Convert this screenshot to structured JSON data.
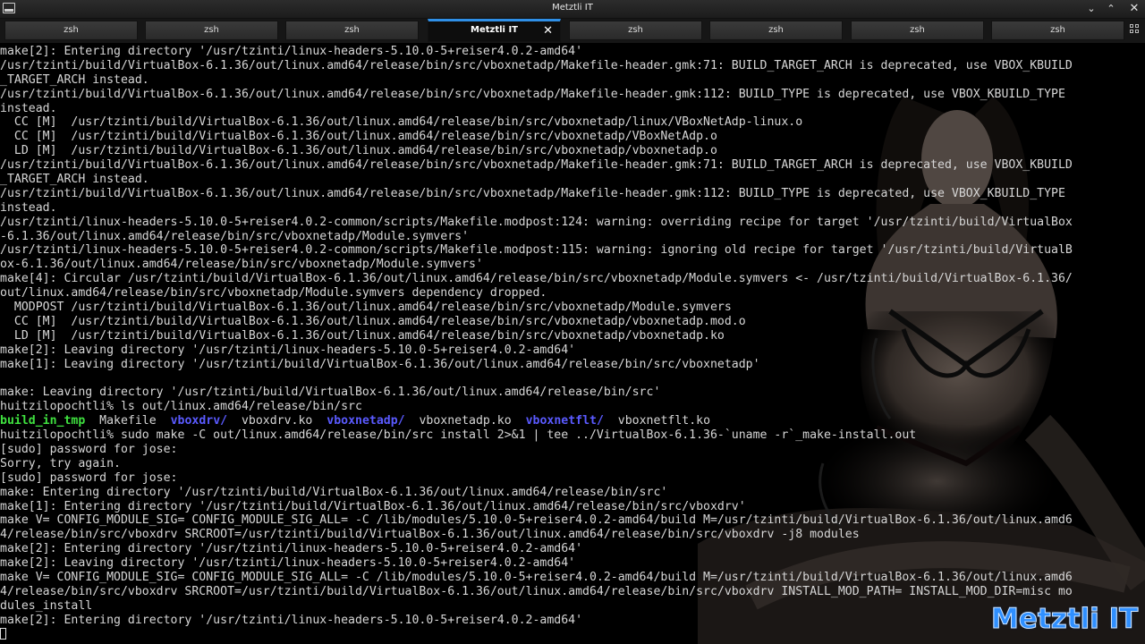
{
  "window": {
    "title": "Metztli IT"
  },
  "controls": {
    "minimize_glyph": "⌄",
    "maximize_glyph": "⌃",
    "close_glyph": "✕"
  },
  "tabs": [
    {
      "label": "zsh"
    },
    {
      "label": "zsh"
    },
    {
      "label": "zsh"
    },
    {
      "label": "Metztli IT",
      "active": true
    },
    {
      "label": "zsh"
    },
    {
      "label": "zsh"
    },
    {
      "label": "zsh"
    },
    {
      "label": "zsh"
    }
  ],
  "tab_close_glyph": "✕",
  "terminal": {
    "lines": [
      "make[2]: Entering directory '/usr/tzinti/linux-headers-5.10.0-5+reiser4.0.2-amd64'",
      "/usr/tzinti/build/VirtualBox-6.1.36/out/linux.amd64/release/bin/src/vboxnetadp/Makefile-header.gmk:71: BUILD_TARGET_ARCH is deprecated, use VBOX_KBUILD",
      "_TARGET_ARCH instead.",
      "/usr/tzinti/build/VirtualBox-6.1.36/out/linux.amd64/release/bin/src/vboxnetadp/Makefile-header.gmk:112: BUILD_TYPE is deprecated, use VBOX_KBUILD_TYPE",
      "instead.",
      "  CC [M]  /usr/tzinti/build/VirtualBox-6.1.36/out/linux.amd64/release/bin/src/vboxnetadp/linux/VBoxNetAdp-linux.o",
      "  CC [M]  /usr/tzinti/build/VirtualBox-6.1.36/out/linux.amd64/release/bin/src/vboxnetadp/VBoxNetAdp.o",
      "  LD [M]  /usr/tzinti/build/VirtualBox-6.1.36/out/linux.amd64/release/bin/src/vboxnetadp/vboxnetadp.o",
      "/usr/tzinti/build/VirtualBox-6.1.36/out/linux.amd64/release/bin/src/vboxnetadp/Makefile-header.gmk:71: BUILD_TARGET_ARCH is deprecated, use VBOX_KBUILD",
      "_TARGET_ARCH instead.",
      "/usr/tzinti/build/VirtualBox-6.1.36/out/linux.amd64/release/bin/src/vboxnetadp/Makefile-header.gmk:112: BUILD_TYPE is deprecated, use VBOX_KBUILD_TYPE",
      "instead.",
      "/usr/tzinti/linux-headers-5.10.0-5+reiser4.0.2-common/scripts/Makefile.modpost:124: warning: overriding recipe for target '/usr/tzinti/build/VirtualBox",
      "-6.1.36/out/linux.amd64/release/bin/src/vboxnetadp/Module.symvers'",
      "/usr/tzinti/linux-headers-5.10.0-5+reiser4.0.2-common/scripts/Makefile.modpost:115: warning: ignoring old recipe for target '/usr/tzinti/build/VirtualB",
      "ox-6.1.36/out/linux.amd64/release/bin/src/vboxnetadp/Module.symvers'",
      "make[4]: Circular /usr/tzinti/build/VirtualBox-6.1.36/out/linux.amd64/release/bin/src/vboxnetadp/Module.symvers <- /usr/tzinti/build/VirtualBox-6.1.36/",
      "out/linux.amd64/release/bin/src/vboxnetadp/Module.symvers dependency dropped.",
      "  MODPOST /usr/tzinti/build/VirtualBox-6.1.36/out/linux.amd64/release/bin/src/vboxnetadp/Module.symvers",
      "  CC [M]  /usr/tzinti/build/VirtualBox-6.1.36/out/linux.amd64/release/bin/src/vboxnetadp/vboxnetadp.mod.o",
      "  LD [M]  /usr/tzinti/build/VirtualBox-6.1.36/out/linux.amd64/release/bin/src/vboxnetadp/vboxnetadp.ko",
      "make[2]: Leaving directory '/usr/tzinti/linux-headers-5.10.0-5+reiser4.0.2-amd64'",
      "make[1]: Leaving directory '/usr/tzinti/build/VirtualBox-6.1.36/out/linux.amd64/release/bin/src/vboxnetadp'",
      "",
      "make: Leaving directory '/usr/tzinti/build/VirtualBox-6.1.36/out/linux.amd64/release/bin/src'",
      "huitzilopochtli% ls out/linux.amd64/release/bin/src"
    ],
    "ls_listing": [
      {
        "text": "build_in_tmp",
        "kind": "dir-green"
      },
      {
        "text": "  Makefile  ",
        "kind": "plain"
      },
      {
        "text": "vboxdrv/",
        "kind": "dir-blue"
      },
      {
        "text": "  vboxdrv.ko  ",
        "kind": "plain"
      },
      {
        "text": "vboxnetadp/",
        "kind": "dir-blue"
      },
      {
        "text": "  vboxnetadp.ko  ",
        "kind": "plain"
      },
      {
        "text": "vboxnetflt/",
        "kind": "dir-blue"
      },
      {
        "text": "  vboxnetflt.ko",
        "kind": "plain"
      }
    ],
    "lines_after": [
      "huitzilopochtli% sudo make -C out/linux.amd64/release/bin/src install 2>&1 | tee ../VirtualBox-6.1.36-`uname -r`_make-install.out",
      "[sudo] password for jose:",
      "Sorry, try again.",
      "[sudo] password for jose:",
      "make: Entering directory '/usr/tzinti/build/VirtualBox-6.1.36/out/linux.amd64/release/bin/src'",
      "make[1]: Entering directory '/usr/tzinti/build/VirtualBox-6.1.36/out/linux.amd64/release/bin/src/vboxdrv'",
      "make V= CONFIG_MODULE_SIG= CONFIG_MODULE_SIG_ALL= -C /lib/modules/5.10.0-5+reiser4.0.2-amd64/build M=/usr/tzinti/build/VirtualBox-6.1.36/out/linux.amd6",
      "4/release/bin/src/vboxdrv SRCROOT=/usr/tzinti/build/VirtualBox-6.1.36/out/linux.amd64/release/bin/src/vboxdrv -j8 modules",
      "make[2]: Entering directory '/usr/tzinti/linux-headers-5.10.0-5+reiser4.0.2-amd64'",
      "make[2]: Leaving directory '/usr/tzinti/linux-headers-5.10.0-5+reiser4.0.2-amd64'",
      "make V= CONFIG_MODULE_SIG= CONFIG_MODULE_SIG_ALL= -C /lib/modules/5.10.0-5+reiser4.0.2-amd64/build M=/usr/tzinti/build/VirtualBox-6.1.36/out/linux.amd6",
      "4/release/bin/src/vboxdrv SRCROOT=/usr/tzinti/build/VirtualBox-6.1.36/out/linux.amd64/release/bin/src/vboxdrv INSTALL_MOD_PATH= INSTALL_MOD_DIR=misc mo",
      "dules_install",
      "make[2]: Entering directory '/usr/tzinti/linux-headers-5.10.0-5+reiser4.0.2-amd64'"
    ]
  },
  "watermark": {
    "text": "Metztli IT",
    "color": "#2f8fff"
  }
}
